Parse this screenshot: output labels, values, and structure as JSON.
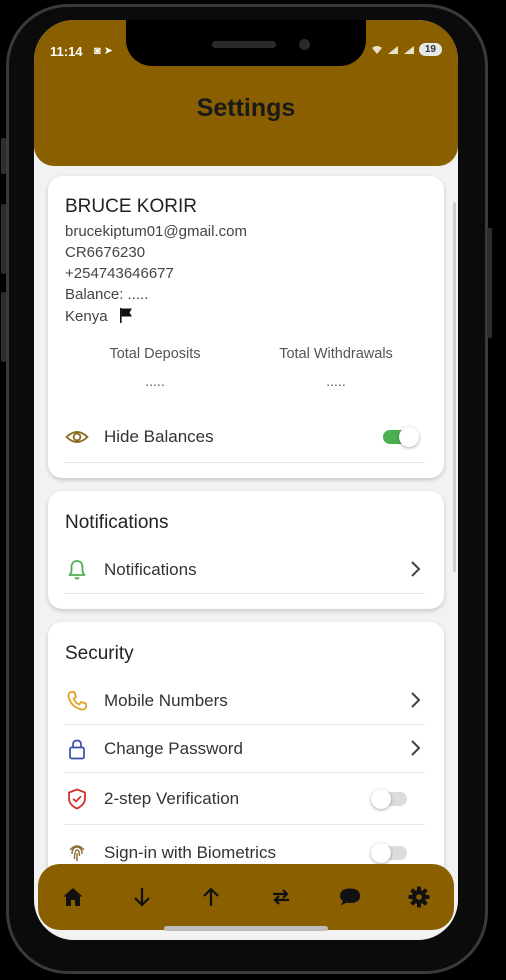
{
  "status_bar": {
    "time": "11:14",
    "battery": "19"
  },
  "header": {
    "title": "Settings"
  },
  "profile": {
    "name": "BRUCE KORIR",
    "email": "brucekiptum01@gmail.com",
    "id": "CR6676230",
    "phone": "+254743646677",
    "balance": "Balance: .....",
    "country": "Kenya",
    "total_deposits_label": "Total Deposits",
    "total_deposits_value": ".....",
    "total_withdrawals_label": "Total Withdrawals",
    "total_withdrawals_value": ".....",
    "hide_balances_label": "Hide Balances",
    "hide_balances_on": true
  },
  "notifications": {
    "title": "Notifications",
    "item_label": "Notifications"
  },
  "security": {
    "title": "Security",
    "items": [
      {
        "label": "Mobile Numbers",
        "icon": "phone-icon"
      },
      {
        "label": "Change Password",
        "icon": "lock-icon"
      },
      {
        "label": "2-step Verification",
        "icon": "shield-check-icon",
        "toggle_on": false
      },
      {
        "label": "Sign-in with Biometrics",
        "icon": "fingerprint-icon",
        "toggle_on": false
      }
    ]
  },
  "bottom_nav": {
    "items": [
      "home-icon",
      "arrow-down-icon",
      "arrow-up-icon",
      "transfer-icon",
      "chat-icon",
      "gear-icon"
    ]
  },
  "colors": {
    "brand": "#8a5f00",
    "toggle_on": "#4caf50",
    "toggle_off": "#dcdcdc",
    "phone_icon": "#e0a020",
    "lock_icon": "#3a4fa8",
    "shield_icon": "#d32f2f",
    "bell_icon": "#4caf50",
    "eye_icon": "#8a6d1e"
  }
}
